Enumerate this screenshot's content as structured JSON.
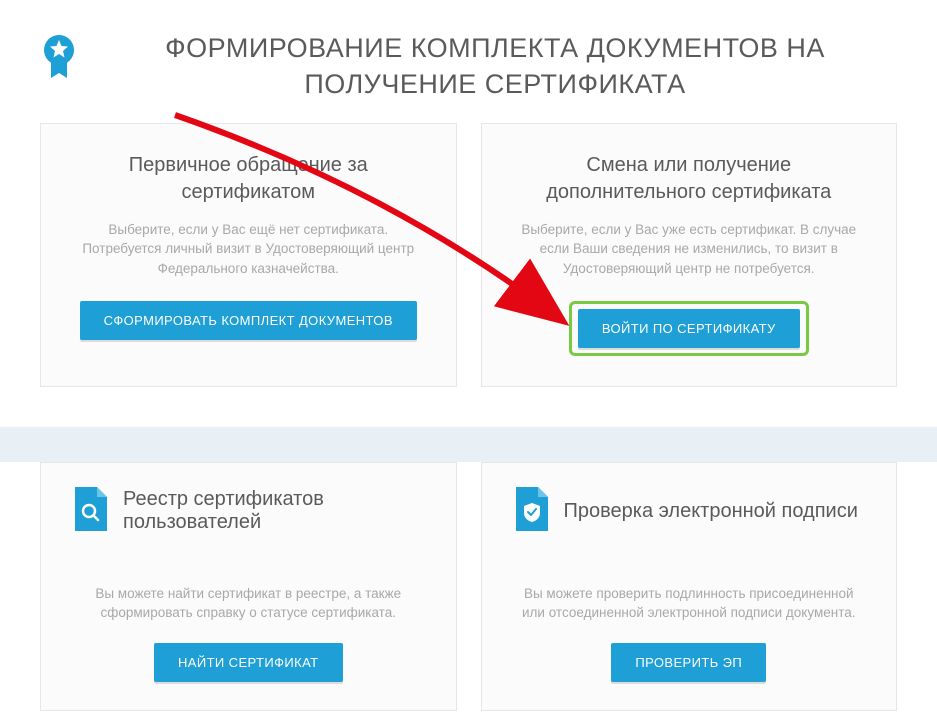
{
  "header": {
    "title": "ФОРМИРОВАНИЕ КОМПЛЕКТА ДОКУМЕНТОВ НА ПОЛУЧЕНИЕ СЕРТИФИКАТА"
  },
  "cards": {
    "primary": {
      "title": "Первичное обращение за сертификатом",
      "desc": "Выберите, если у Вас ещё нет сертификата. Потребуется личный визит в Удостоверяющий центр Федерального казначейства.",
      "button": "СФОРМИРОВАТЬ КОМПЛЕКТ ДОКУМЕНТОВ"
    },
    "secondary": {
      "title": "Смена или получение дополнительного сертификата",
      "desc": "Выберите, если у Вас уже есть сертификат. В случае если Ваши сведения не изменились, то визит в Удостоверяющий центр не потребуется.",
      "button": "ВОЙТИ ПО СЕРТИФИКАТУ"
    }
  },
  "bottom": {
    "registry": {
      "title": "Реестр сертификатов пользователей",
      "desc": "Вы можете найти сертификат в реестре, а также сформировать справку о статусе сертификата.",
      "button": "НАЙТИ СЕРТИФИКАТ"
    },
    "verify": {
      "title": "Проверка электронной подписи",
      "desc": "Вы можете проверить подлинность присоединенной или отсоединенной электронной подписи документа.",
      "button": "ПРОВЕРИТЬ ЭП"
    }
  }
}
